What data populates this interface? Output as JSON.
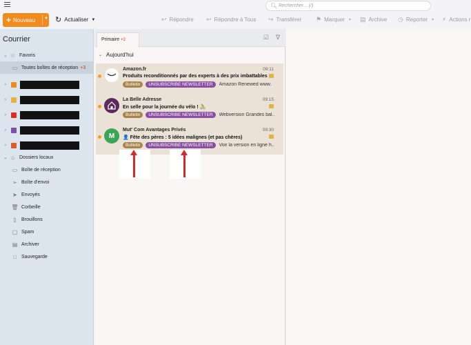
{
  "search": {
    "placeholder": "Rechercher... (/)"
  },
  "toolbar": {
    "new_label": "Nouveau",
    "refresh_label": "Actualiser",
    "reply": "Répondre",
    "reply_all": "Répondre à Tous",
    "forward": "Transférer",
    "mark": "Marquer",
    "archive": "Archive",
    "report": "Reporter",
    "actions": "Actions r"
  },
  "sidebar": {
    "title": "Courrier",
    "favorites": "Favoris",
    "all_inboxes": "Toutes boîtes de réception",
    "all_inboxes_badge": "+3",
    "local_folders": "Dossiers locaux",
    "folders": [
      "Boîte de réception",
      "Boîte d'envoi",
      "Envoyés",
      "Corbeille",
      "Brouillons",
      "Spam",
      "Archiver",
      "Sauvegarde"
    ]
  },
  "list": {
    "tab_primary": "Primaire",
    "tab_count": "+2",
    "group_today": "Aujourd'hui",
    "messages": [
      {
        "sender": "Amazon.fr",
        "time": "09:11",
        "subject": "Produits reconditionnés par des experts à des prix imbattables",
        "tag1": "Bulletin",
        "tag2": "UNSUBSCRIBE NEWSLETTER",
        "preview": "Amazon Renewed www.",
        "avatar_letter": ""
      },
      {
        "sender": "La Belle Adresse",
        "time": "09:15",
        "subject": "En selle pour la journée du vélo ! 🚴",
        "tag1": "Bulletin",
        "tag2": "UNSUBSCRIBE NEWSLETTER",
        "preview": "Webversion Grandes bal..",
        "avatar_letter": ""
      },
      {
        "sender": "Mut' Com Avantages Privés",
        "time": "09:30",
        "subject": "👤 Fête des pères : 5 idées malignes (et pas chères)",
        "tag1": "Bulletin",
        "tag2": "UNSUBSCRIBE NEWSLETTER",
        "preview": "Voir la version en ligne h..",
        "avatar_letter": "M"
      }
    ]
  },
  "colors": {
    "accent": "#f18b1d",
    "bulletin": "#a8834a",
    "unsubscribe": "#8a4fa3",
    "arrow": "#d62a2a",
    "message_bg": "#ebe2d7",
    "sidebar_bg": "#dce5ee"
  }
}
